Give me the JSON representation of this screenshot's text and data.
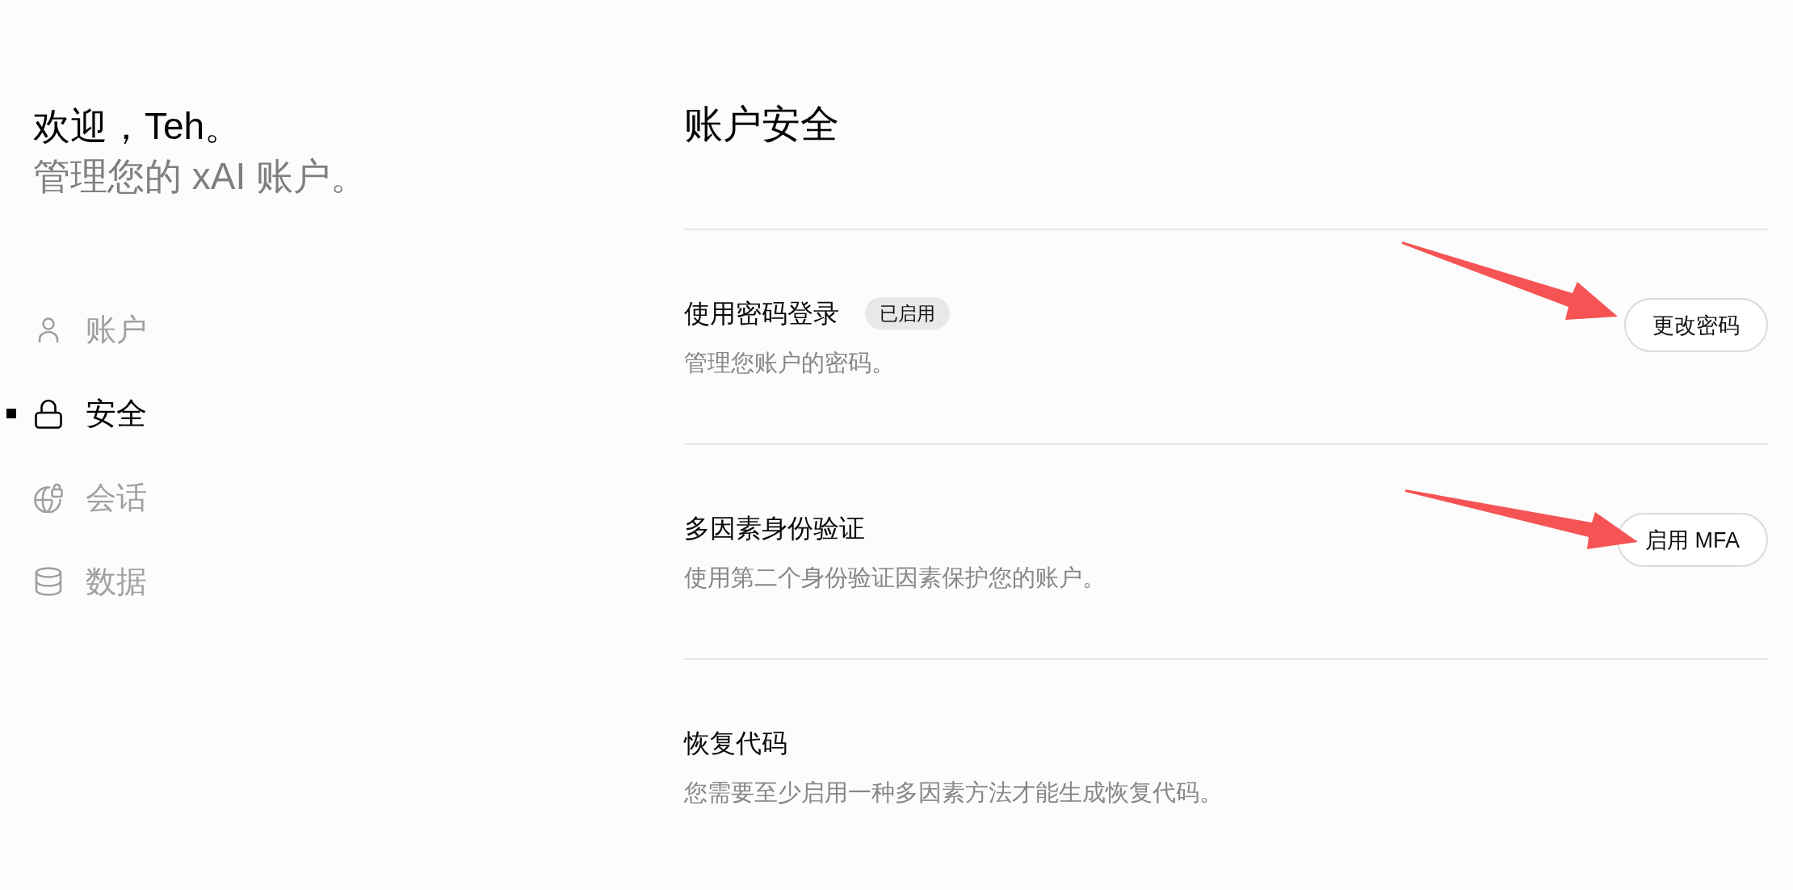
{
  "sidebar": {
    "greeting": "欢迎，Teh。",
    "subtitle": "管理您的 xAI 账户。",
    "items": [
      {
        "label": "账户",
        "kind": "account",
        "selected": false
      },
      {
        "label": "安全",
        "kind": "security",
        "selected": true
      },
      {
        "label": "会话",
        "kind": "sessions",
        "selected": false
      },
      {
        "label": "数据",
        "kind": "data",
        "selected": false
      }
    ]
  },
  "main": {
    "title": "账户安全",
    "sections": [
      {
        "title": "使用密码登录",
        "badge": "已启用",
        "description": "管理您账户的密码。",
        "button": "更改密码",
        "arrow": true
      },
      {
        "title": "多因素身份验证",
        "description": "使用第二个身份验证因素保护您的账户。",
        "button": "启用 MFA",
        "arrow": true
      },
      {
        "title": "恢复代码",
        "description": "您需要至少启用一种多因素方法才能生成恢复代码。",
        "arrow": false
      }
    ]
  }
}
